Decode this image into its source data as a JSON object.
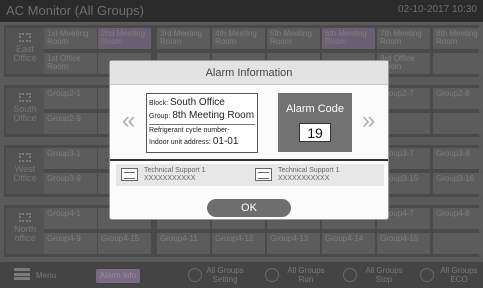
{
  "title_bar": {
    "title": "AC Monitor (All Groups)",
    "datetime": "02-10-2017 10:30"
  },
  "sections": [
    {
      "label": "East Office",
      "row1": [
        "1st Meeting Room",
        "2nd Meeting Room",
        "3rd Meeting Room",
        "4th Meeting Room",
        "5th Meeting Room",
        "6th Meeting Room",
        "7th Meeting Room",
        "8th Meeting Room"
      ],
      "row2": [
        "1st Office Room",
        "",
        "",
        "",
        "",
        "",
        "3rd Office Room",
        ""
      ]
    },
    {
      "label": "South Office",
      "row1": [
        "Group2-1",
        "",
        "",
        "",
        "",
        "",
        "Group2-7",
        "Group2-8"
      ],
      "row2": [
        "Group2-9",
        "",
        "",
        "",
        "",
        "",
        "",
        ""
      ]
    },
    {
      "label": "West Office",
      "row1": [
        "Group3-1",
        "",
        "",
        "",
        "",
        "",
        "Group3-7",
        "Group3-8"
      ],
      "row2": [
        "Group3-9",
        "",
        "",
        "",
        "",
        "",
        "Group3-15",
        "Group3-16"
      ]
    },
    {
      "label": "North office",
      "row1": [
        "Group4-1",
        "",
        "",
        "",
        "",
        "",
        "Group4-7",
        "Group4-8"
      ],
      "row2": [
        "Group4-9",
        "Group4-15",
        "Group4-11",
        "Group4-12",
        "Group4-13",
        "Group4-14",
        "Group4-15",
        ""
      ]
    }
  ],
  "bottom_bar": {
    "menu": "Menu",
    "alarm_info": "Alarm Info",
    "all_setting": "All Groups Setting",
    "all_run": "All Groups Run",
    "all_stop": "All Groups Stop",
    "all_eco": "All Groups ECO"
  },
  "modal": {
    "title": "Alarm Information",
    "prev_arrow": "«",
    "next_arrow": "»",
    "block_label": "Block:",
    "block_value": "South Office",
    "group_label": "Group:",
    "group_value": "8th Meeting Room",
    "refrigerant_label": "Refrigerant cycle number-",
    "indoor_label": "Indoor unit address:",
    "indoor_value": "01-01",
    "alarm_code_label": "Alarm Code",
    "alarm_code_value": "19",
    "support": [
      {
        "name": "Technical Support 1",
        "phone": "XXXXXXXXXXX"
      },
      {
        "name": "Technical Support 1",
        "phone": "XXXXXXXXXXX"
      }
    ],
    "ok_label": "OK"
  }
}
